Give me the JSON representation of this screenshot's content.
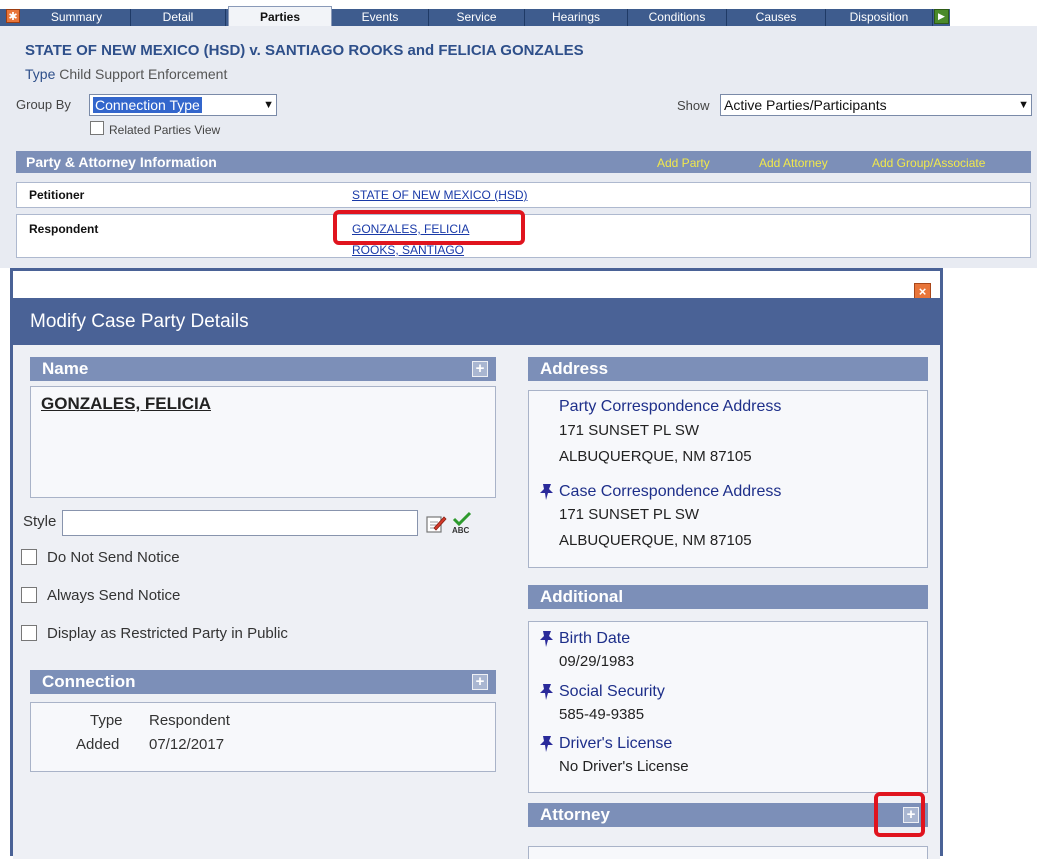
{
  "tabs": {
    "items": [
      {
        "label": "Summary"
      },
      {
        "label": "Detail"
      },
      {
        "label": "Parties"
      },
      {
        "label": "Events"
      },
      {
        "label": "Service"
      },
      {
        "label": "Hearings"
      },
      {
        "label": "Conditions"
      },
      {
        "label": "Causes"
      },
      {
        "label": "Disposition"
      }
    ],
    "active": "Parties"
  },
  "case": {
    "title": "STATE OF NEW MEXICO (HSD) v. SANTIAGO ROOKS and FELICIA GONZALES",
    "type_label": "Type",
    "type_value": "Child Support Enforcement",
    "group_by_label": "Group By",
    "group_by_value": "Connection Type",
    "related_parties_label": "Related Parties View",
    "show_label": "Show",
    "show_value": "Active Parties/Participants"
  },
  "party_section": {
    "title": "Party & Attorney Information",
    "add_party": "Add Party",
    "add_attorney": "Add Attorney",
    "add_group": "Add Group/Associate",
    "rows": [
      {
        "role": "Petitioner",
        "names": [
          "STATE OF NEW MEXICO (HSD)"
        ]
      },
      {
        "role": "Respondent",
        "names": [
          "GONZALES, FELICIA",
          "ROOKS, SANTIAGO"
        ]
      }
    ]
  },
  "modal": {
    "title": "Modify Case Party Details",
    "close_label": "×",
    "name_section": {
      "title": "Name",
      "value": "GONZALES, FELICIA",
      "style_label": "Style",
      "style_value": "",
      "checkboxes": [
        "Do Not Send Notice",
        "Always Send Notice",
        "Display as Restricted Party in Public"
      ]
    },
    "connection_section": {
      "title": "Connection",
      "type_label": "Type",
      "type_value": "Respondent",
      "added_label": "Added",
      "added_value": "07/12/2017"
    },
    "address_section": {
      "title": "Address",
      "addresses": [
        {
          "title": "Party Correspondence Address",
          "line1": "171 SUNSET PL SW",
          "line2": "ALBUQUERQUE, NM 87105"
        },
        {
          "title": "Case Correspondence Address",
          "line1": "171 SUNSET PL SW",
          "line2": "ALBUQUERQUE, NM 87105"
        }
      ]
    },
    "additional_section": {
      "title": "Additional",
      "items": [
        {
          "label": "Birth Date",
          "value": "09/29/1983"
        },
        {
          "label": "Social Security",
          "value": "585-49-9385"
        },
        {
          "label": "Driver's License",
          "value": "No Driver's License"
        }
      ]
    },
    "attorney_section": {
      "title": "Attorney"
    }
  },
  "colors": {
    "header_blue": "#4a6296",
    "section_bar": "#7c8fb8",
    "link_blue": "#1e2f8a",
    "highlight_red": "#e0141e",
    "add_link_yellow": "#f2e94a"
  }
}
